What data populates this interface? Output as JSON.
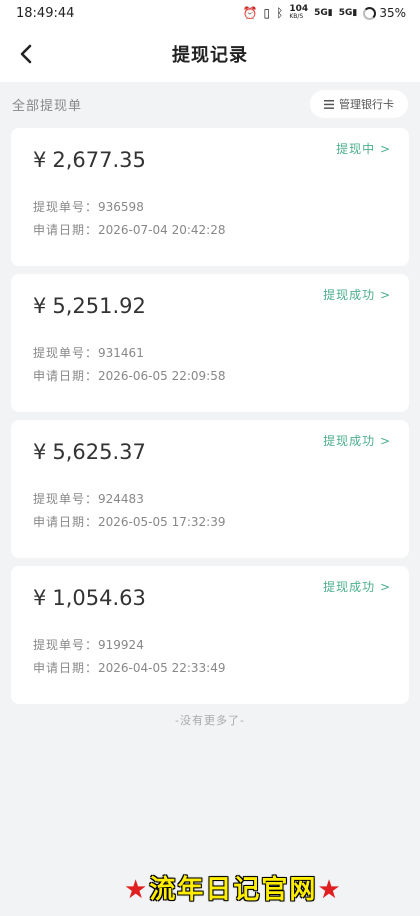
{
  "status_bar": {
    "time": "18:49:44",
    "network": "104",
    "network_unit": "KB/S",
    "signal1": "5G",
    "signal2": "5G",
    "battery": "35%"
  },
  "nav": {
    "title": "提现记录"
  },
  "sub_header": {
    "title": "全部提现单",
    "manage_label": "管理银行卡"
  },
  "labels": {
    "order_no": "提现单号：",
    "apply_date": "申请日期："
  },
  "records": [
    {
      "currency": "¥",
      "amount": "2,677.35",
      "status": "提现中 >",
      "order_no": "936598",
      "date": "2026-07-04 20:42:28"
    },
    {
      "currency": "¥",
      "amount": "5,251.92",
      "status": "提现成功 >",
      "order_no": "931461",
      "date": "2026-06-05 22:09:58"
    },
    {
      "currency": "¥",
      "amount": "5,625.37",
      "status": "提现成功 >",
      "order_no": "924483",
      "date": "2026-05-05 17:32:39"
    },
    {
      "currency": "¥",
      "amount": "1,054.63",
      "status": "提现成功 >",
      "order_no": "919924",
      "date": "2026-04-05 22:33:49"
    }
  ],
  "footer_tip": "-没有更多了-",
  "watermark": {
    "star": "★",
    "text": "流年日记官网"
  },
  "colors": {
    "accent": "#4caf8d",
    "background": "#f2f3f5",
    "watermark_text": "#ffee00",
    "watermark_star": "#e02020"
  },
  "icons": {
    "back": "chevron-left-icon",
    "menu": "menu-icon"
  }
}
